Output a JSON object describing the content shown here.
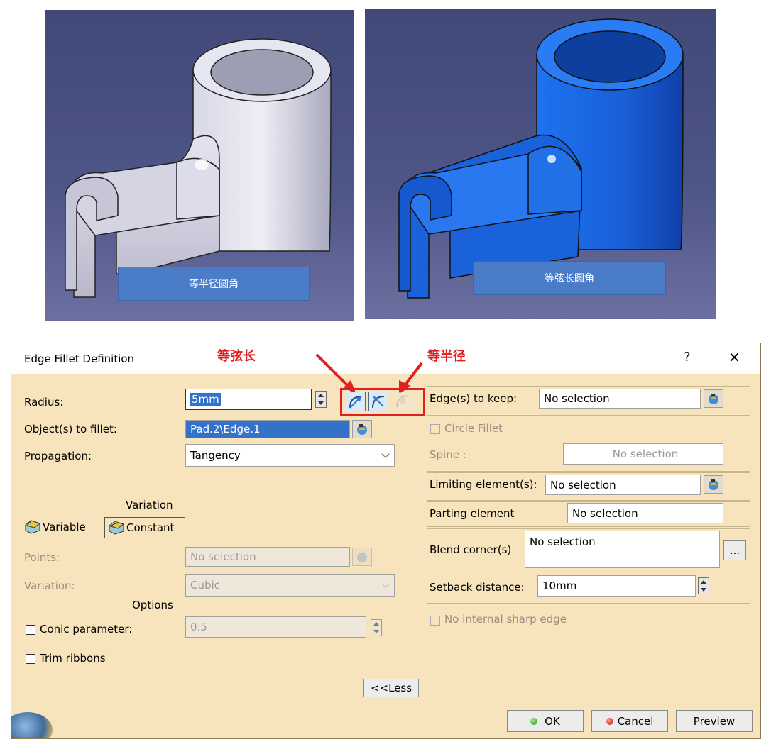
{
  "images": {
    "left_caption": "等半径圆角",
    "right_caption": "等弦长圆角"
  },
  "dialog": {
    "title": "Edge Fillet Definition",
    "help": "?",
    "close": "✕",
    "annotation_left": "等弦长",
    "annotation_right": "等半径",
    "radius_label": "Radius:",
    "radius_value": "5mm",
    "objects_label": "Object(s) to fillet:",
    "objects_value": "Pad.2\\Edge.1",
    "propagation_label": "Propagation:",
    "propagation_value": "Tangency",
    "variation_section": "Variation",
    "variable_label": "Variable",
    "constant_label": "Constant",
    "points_label": "Points:",
    "points_value": "No selection",
    "variation_label": "Variation:",
    "variation_value": "Cubic",
    "options_section": "Options",
    "conic_label": "Conic parameter:",
    "conic_value": "0.5",
    "trim_label": "Trim ribbons",
    "less_button": "<<Less",
    "edges_keep_label": "Edge(s) to keep:",
    "edges_keep_value": "No selection",
    "circle_fillet_label": "Circle Fillet",
    "spine_label": "Spine :",
    "spine_value": "No selection",
    "limiting_label": "Limiting element(s):",
    "limiting_value": "No selection",
    "parting_label": "Parting element",
    "parting_value": "No selection",
    "blend_label": "Blend corner(s)",
    "blend_value": "No selection",
    "blend_more": "...",
    "setback_label": "Setback distance:",
    "setback_value": "10mm",
    "no_sharp_label": "No internal sharp edge",
    "ok_button": "OK",
    "cancel_button": "Cancel",
    "preview_button": "Preview"
  },
  "colors": {
    "dialog_bg": "#f7e4bc",
    "highlight_red": "#e02020",
    "selection_blue": "#3471c9",
    "part_blue": "#1565e8",
    "part_grey": "#c8c8d8"
  }
}
